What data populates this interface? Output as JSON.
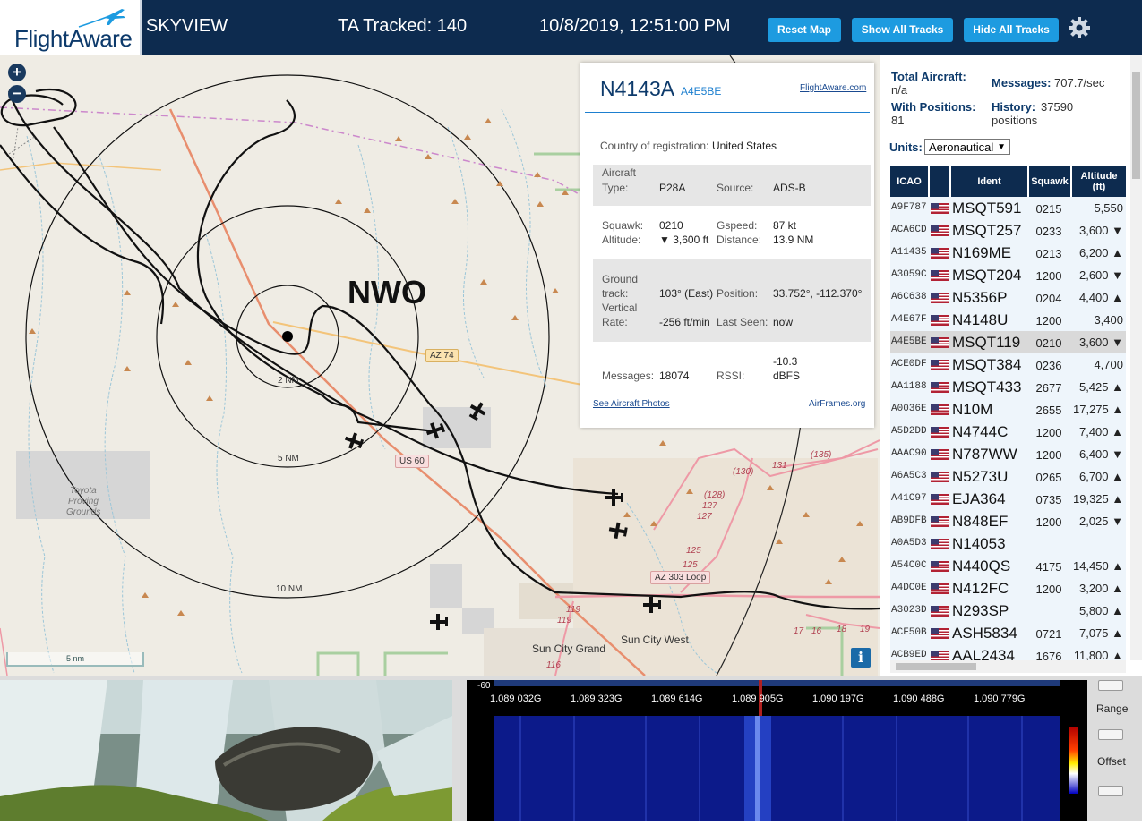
{
  "header": {
    "logo_text": "FlightAware",
    "app_name": "SKYVIEW",
    "tracked": "TA Tracked: 140",
    "datetime": "10/8/2019, 12:51:00 PM",
    "buttons": [
      "Reset Map",
      "Show All Tracks",
      "Hide All Tracks"
    ],
    "bg_color": "#0d2b4f",
    "button_color": "#1d9be0"
  },
  "map": {
    "station": "NWO",
    "range_labels": [
      "2 NM",
      "5 NM",
      "10 NM"
    ],
    "scale": "5 nm",
    "zoom_in": "+",
    "zoom_out": "−",
    "info": "i",
    "places": [
      "Toyota",
      "Proving",
      "Grounds",
      "Sun City Grand",
      "Sun City West"
    ],
    "road_signs": [
      "AZ 74",
      "US 60",
      "AZ 303 Loop"
    ],
    "road_numbers": [
      "(130)",
      "131",
      "(135)",
      "(128)",
      "127",
      "127",
      "125",
      "125",
      "119",
      "119",
      "116",
      "17",
      "16",
      "18",
      "19"
    ]
  },
  "popup": {
    "ident": "N4143A",
    "hex": "A4E5BE",
    "fa_link": "FlightAware.com",
    "country_label": "Country of registration:",
    "country": "United States",
    "type_label_1": "Aircraft",
    "type_label_2": "Type:",
    "type": "P28A",
    "source_label": "Source:",
    "source": "ADS-B",
    "squawk_label": "Squawk:",
    "squawk": "0210",
    "gspeed_label": "Gspeed:",
    "gspeed": "87 kt",
    "altitude_label": "Altitude:",
    "altitude": "▼ 3,600 ft",
    "distance_label": "Distance:",
    "distance": "13.9 NM",
    "track_label_1": "Ground",
    "track_label_2": "track:",
    "track": "103° (East)",
    "position_label": "Position:",
    "position": "33.752°, -112.370°",
    "vrate_label_1": "Vertical",
    "vrate_label_2": "Rate:",
    "vrate": "-256 ft/min",
    "lastseen_label": "Last Seen:",
    "lastseen": "now",
    "messages_label": "Messages:",
    "messages": "18074",
    "rssi_label": "RSSI:",
    "rssi_1": "-10.3",
    "rssi_2": "dBFS",
    "photos_link": "See Aircraft Photos",
    "airframes_link": "AirFrames.org"
  },
  "side": {
    "total_label": "Total Aircraft:",
    "total": "n/a",
    "messages_label": "Messages:",
    "messages": "707.7/sec",
    "positions_label": "With Positions:",
    "positions": "81",
    "history_label": "History:",
    "history_1": "37590",
    "history_2": "positions",
    "units_label": "Units:",
    "units_value": "Aeronautical",
    "columns": [
      "ICAO",
      "",
      "Ident",
      "Squawk",
      "Altitude (ft)"
    ],
    "rows": [
      {
        "icao": "A9F787",
        "ident": "MSQT591",
        "squawk": "0215",
        "alt": "5,550"
      },
      {
        "icao": "ACA6CD",
        "ident": "MSQT257",
        "squawk": "0233",
        "alt": "3,600 ▼"
      },
      {
        "icao": "A11435",
        "ident": "N169ME",
        "squawk": "0213",
        "alt": "6,200 ▲"
      },
      {
        "icao": "A3059C",
        "ident": "MSQT204",
        "squawk": "1200",
        "alt": "2,600 ▼"
      },
      {
        "icao": "A6C638",
        "ident": "N5356P",
        "squawk": "0204",
        "alt": "4,400 ▲"
      },
      {
        "icao": "A4E67F",
        "ident": "N4148U",
        "squawk": "1200",
        "alt": "3,400"
      },
      {
        "icao": "A4E5BE",
        "ident": "MSQT119",
        "squawk": "0210",
        "alt": "3,600 ▼"
      },
      {
        "icao": "ACE0DF",
        "ident": "MSQT384",
        "squawk": "0236",
        "alt": "4,700"
      },
      {
        "icao": "AA1188",
        "ident": "MSQT433",
        "squawk": "2677",
        "alt": "5,425 ▲"
      },
      {
        "icao": "A0036E",
        "ident": "N10M",
        "squawk": "2655",
        "alt": "17,275 ▲"
      },
      {
        "icao": "A5D2DD",
        "ident": "N4744C",
        "squawk": "1200",
        "alt": "7,400 ▲"
      },
      {
        "icao": "AAAC90",
        "ident": "N787WW",
        "squawk": "1200",
        "alt": "6,400 ▼"
      },
      {
        "icao": "A6A5C3",
        "ident": "N5273U",
        "squawk": "0265",
        "alt": "6,700 ▲"
      },
      {
        "icao": "A41C97",
        "ident": "EJA364",
        "squawk": "0735",
        "alt": "19,325 ▲"
      },
      {
        "icao": "AB9DFB",
        "ident": "N848EF",
        "squawk": "1200",
        "alt": "2,025 ▼"
      },
      {
        "icao": "A0A5D3",
        "ident": "N14053",
        "squawk": "",
        "alt": ""
      },
      {
        "icao": "A54C0C",
        "ident": "N440QS",
        "squawk": "4175",
        "alt": "14,450 ▲"
      },
      {
        "icao": "A4DC0E",
        "ident": "N412FC",
        "squawk": "1200",
        "alt": "3,200 ▲"
      },
      {
        "icao": "A3023D",
        "ident": "N293SP",
        "squawk": "",
        "alt": "5,800 ▲"
      },
      {
        "icao": "ACF50B",
        "ident": "ASH5834",
        "squawk": "0721",
        "alt": "7,075 ▲"
      },
      {
        "icao": "ACB9ED",
        "ident": "AAL2434",
        "squawk": "1676",
        "alt": "11,800 ▲"
      }
    ],
    "selected_row": 6
  },
  "sdr": {
    "level": "-60",
    "freqs": [
      "1.089 032G",
      "1.089 323G",
      "1.089 614G",
      "1.089 905G",
      "1.090 197G",
      "1.090 488G",
      "1.090 779G"
    ],
    "range_label": "Range",
    "offset_label": "Offset"
  }
}
